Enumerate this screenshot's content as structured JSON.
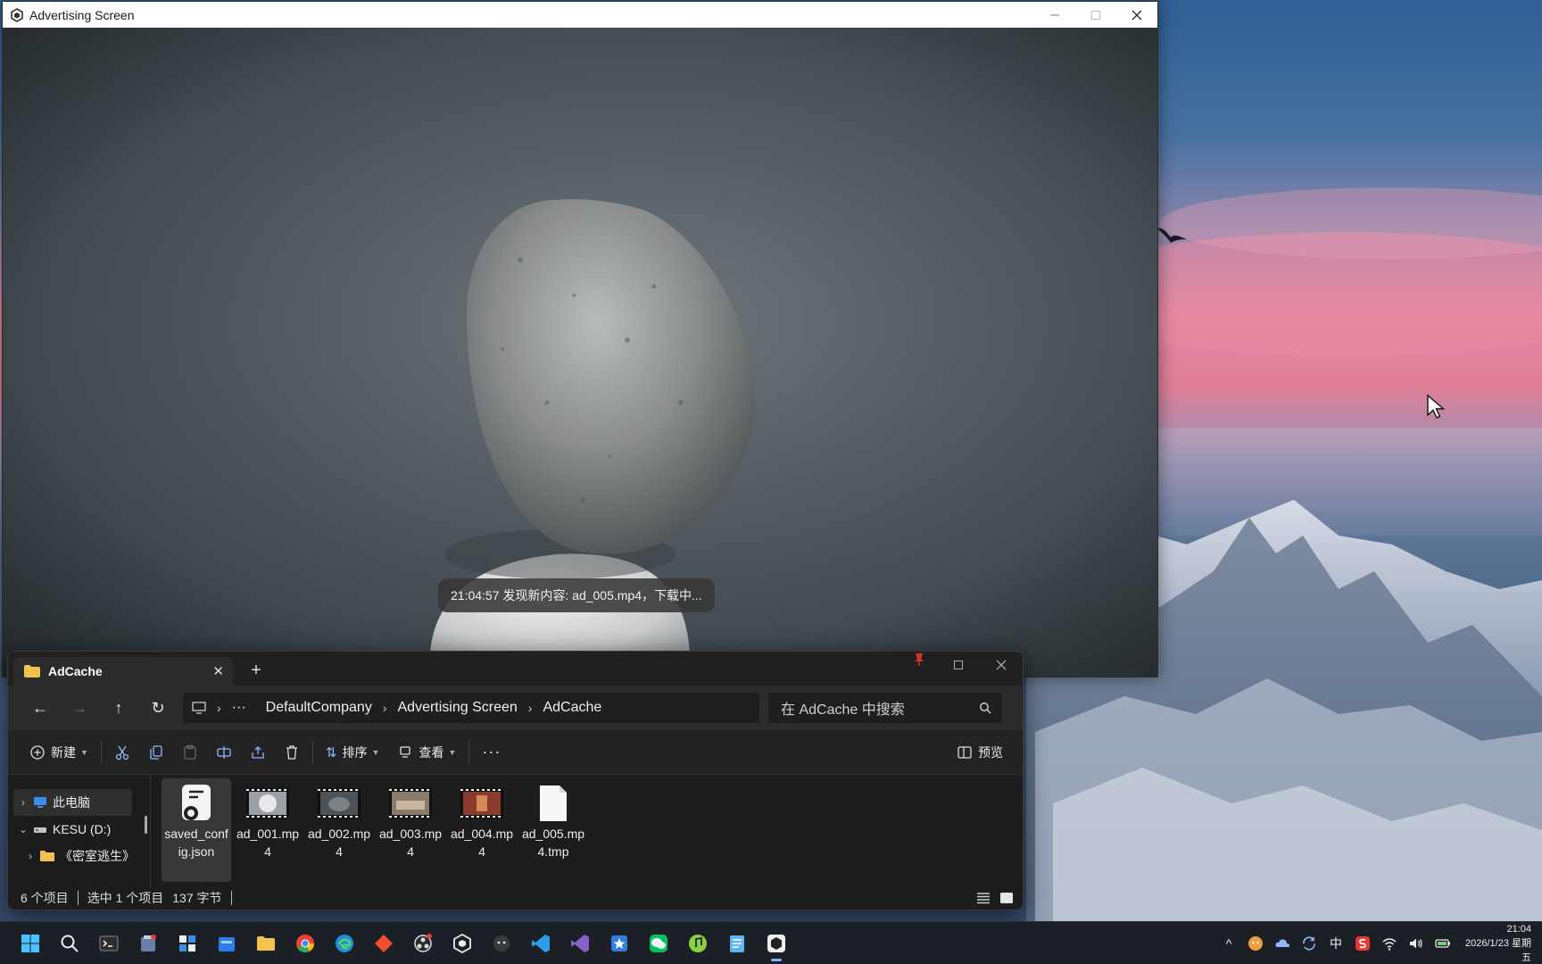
{
  "ad_window": {
    "title": "Advertising Screen",
    "toast": "21:04:57 发现新内容: ad_005.mp4，下载中..."
  },
  "explorer": {
    "tab_label": "AdCache",
    "breadcrumb": [
      "DefaultCompany",
      "Advertising Screen",
      "AdCache"
    ],
    "search_placeholder": "在 AdCache 中搜索",
    "toolbar": {
      "new_label": "新建",
      "sort_label": "排序",
      "view_label": "查看",
      "preview_label": "预览"
    },
    "nav": {
      "this_pc": "此电脑",
      "drive": "KESU (D:)",
      "folder": "《密室逃生》"
    },
    "files": [
      {
        "name": "saved_config.json",
        "kind": "json"
      },
      {
        "name": "ad_001.mp4",
        "kind": "video"
      },
      {
        "name": "ad_002.mp4",
        "kind": "video"
      },
      {
        "name": "ad_003.mp4",
        "kind": "video"
      },
      {
        "name": "ad_004.mp4",
        "kind": "video"
      },
      {
        "name": "ad_005.mp4.tmp",
        "kind": "file"
      }
    ],
    "status": {
      "count": "6 个项目",
      "selected": "选中 1 个项目",
      "size": "137 字节"
    }
  },
  "taskbar": {
    "tray_ime": "中",
    "time": "21:04",
    "date": "2026/1/23 星期五"
  },
  "colors": {
    "explorer_bg": "#1c1c1c",
    "accent": "#7fb5ff",
    "taskbar_bg": "#1b1f26"
  }
}
